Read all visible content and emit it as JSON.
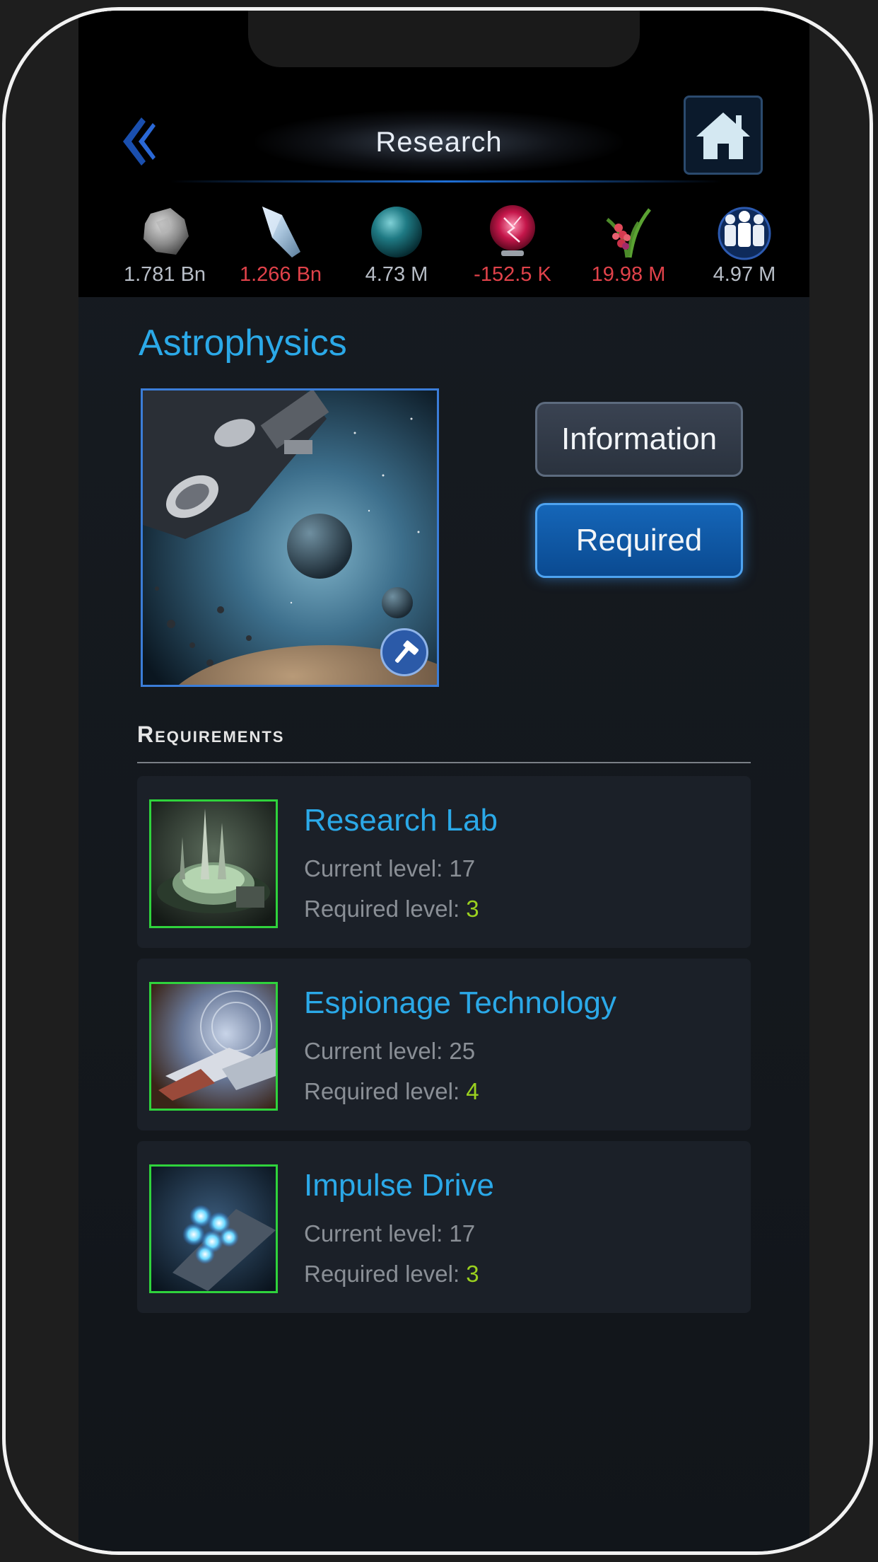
{
  "header": {
    "title": "Research",
    "back_icon": "double-chevron-left-icon",
    "home_icon": "home-icon"
  },
  "resources": [
    {
      "name": "metal",
      "icon": "metal-rock-icon",
      "value": "1.781 Bn",
      "color": "#b8bec7"
    },
    {
      "name": "crystal",
      "icon": "crystal-icon",
      "value": "1.266 Bn",
      "color": "#e0424a"
    },
    {
      "name": "deuterium",
      "icon": "deuterium-sphere-icon",
      "value": "4.73 M",
      "color": "#b8bec7"
    },
    {
      "name": "energy",
      "icon": "energy-orb-icon",
      "value": "-152.5 K",
      "color": "#e0424a"
    },
    {
      "name": "food",
      "icon": "food-plant-icon",
      "value": "19.98 M",
      "color": "#e0424a"
    },
    {
      "name": "population",
      "icon": "population-icon",
      "value": "4.97 M",
      "color": "#b8bec7"
    }
  ],
  "research": {
    "name": "Astrophysics",
    "build_icon": "hammer-icon",
    "info_button": "Information",
    "required_button": "Required"
  },
  "requirements": {
    "heading": "Requirements",
    "items": [
      {
        "name": "Research Lab",
        "current_label": "Current level: ",
        "current": "17",
        "required_label": "Required level: ",
        "required": "3"
      },
      {
        "name": "Espionage Technology",
        "current_label": "Current level: ",
        "current": "25",
        "required_label": "Required level: ",
        "required": "4"
      },
      {
        "name": "Impulse Drive",
        "current_label": "Current level: ",
        "current": "17",
        "required_label": "Required level: ",
        "required": "3"
      }
    ]
  },
  "colors": {
    "accent": "#2ba9e8",
    "met": "#9bd11f",
    "deficit": "#e0424a"
  }
}
